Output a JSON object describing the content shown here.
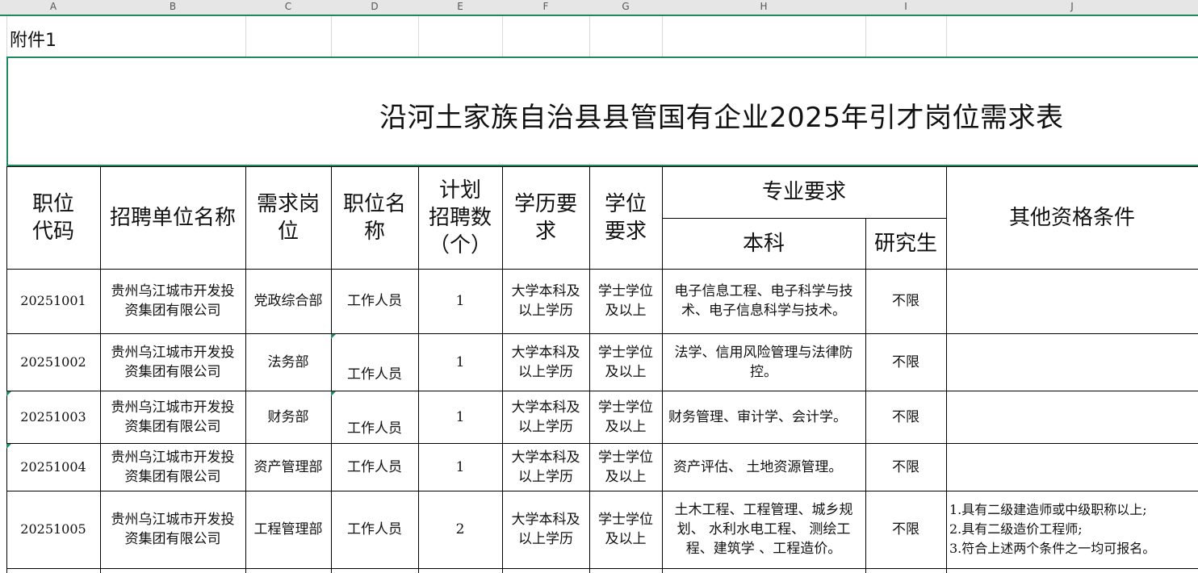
{
  "columns": [
    "A",
    "B",
    "C",
    "D",
    "E",
    "F",
    "G",
    "H",
    "I",
    "J"
  ],
  "attachment_label": "附件1",
  "title": "沿河土家族自治县县管国有企业2025年引才岗位需求表",
  "headers": {
    "code": [
      "职位",
      "代码"
    ],
    "unit": "招聘单位名称",
    "dept": [
      "需求岗",
      "位"
    ],
    "position": [
      "职位名",
      "称"
    ],
    "plan": [
      "计划",
      "招聘数",
      "（个）"
    ],
    "education": [
      "学历要",
      "求"
    ],
    "degree": [
      "学位",
      "要求"
    ],
    "major": "专业要求",
    "bachelor": "本科",
    "graduate": "研究生",
    "other": "其他资格条件"
  },
  "rows": [
    {
      "code": "20251001",
      "unit": [
        "贵州乌江城市开发投",
        "资集团有限公司"
      ],
      "dept": "党政综合部",
      "position": "工作人员",
      "plan": "1",
      "education": [
        "大学本科及",
        "以上学历"
      ],
      "degree": [
        "学士学位",
        "及以上"
      ],
      "bachelor": [
        "电子信息工程、电子科学与技",
        "术、电子信息科学与技术。"
      ],
      "graduate": "不限",
      "other": []
    },
    {
      "code": "20251002",
      "unit": [
        "贵州乌江城市开发投",
        "资集团有限公司"
      ],
      "dept": "法务部",
      "position": "工作人员",
      "plan": "1",
      "education": [
        "大学本科及",
        "以上学历"
      ],
      "degree": [
        "学士学位",
        "及以上"
      ],
      "bachelor": [
        "法学、信用风险管理与法律防",
        "控。"
      ],
      "graduate": "不限",
      "other": []
    },
    {
      "code": "20251003",
      "unit": [
        "贵州乌江城市开发投",
        "资集团有限公司"
      ],
      "dept": "财务部",
      "position": "工作人员",
      "plan": "1",
      "education": [
        "大学本科及",
        "以上学历"
      ],
      "degree": [
        "学士学位",
        "及以上"
      ],
      "bachelor": [
        "财务管理、审计学、会计学。"
      ],
      "graduate": "不限",
      "other": []
    },
    {
      "code": "20251004",
      "unit": [
        "贵州乌江城市开发投",
        "资集团有限公司"
      ],
      "dept": "资产管理部",
      "position": "工作人员",
      "plan": "1",
      "education": [
        "大学本科及",
        "以上学历"
      ],
      "degree": [
        "学士学位",
        "及以上"
      ],
      "bachelor": [
        "资产评估、 土地资源管理。"
      ],
      "graduate": "不限",
      "other": []
    },
    {
      "code": "20251005",
      "unit": [
        "贵州乌江城市开发投",
        "资集团有限公司"
      ],
      "dept": "工程管理部",
      "position": "工作人员",
      "plan": "2",
      "education": [
        "大学本科及",
        "以上学历"
      ],
      "degree": [
        "学士学位",
        "及以上"
      ],
      "bachelor": [
        "土木工程、工程管理、城乡规",
        "划、 水利水电工程、 测绘工",
        "程、建筑学 、工程造价。"
      ],
      "graduate": "不限",
      "other": [
        "1.具有二级建造师或中级职称以上;",
        "2.具有二级造价工程师;",
        "3.符合上述两个条件之一均可报名。"
      ]
    }
  ]
}
